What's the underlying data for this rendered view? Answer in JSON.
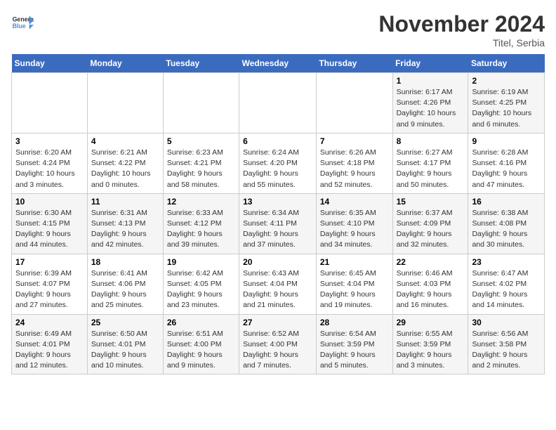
{
  "logo": {
    "text_general": "General",
    "text_blue": "Blue"
  },
  "title": "November 2024",
  "location": "Titel, Serbia",
  "days_of_week": [
    "Sunday",
    "Monday",
    "Tuesday",
    "Wednesday",
    "Thursday",
    "Friday",
    "Saturday"
  ],
  "weeks": [
    [
      {
        "day": "",
        "info": ""
      },
      {
        "day": "",
        "info": ""
      },
      {
        "day": "",
        "info": ""
      },
      {
        "day": "",
        "info": ""
      },
      {
        "day": "",
        "info": ""
      },
      {
        "day": "1",
        "info": "Sunrise: 6:17 AM\nSunset: 4:26 PM\nDaylight: 10 hours and 9 minutes."
      },
      {
        "day": "2",
        "info": "Sunrise: 6:19 AM\nSunset: 4:25 PM\nDaylight: 10 hours and 6 minutes."
      }
    ],
    [
      {
        "day": "3",
        "info": "Sunrise: 6:20 AM\nSunset: 4:24 PM\nDaylight: 10 hours and 3 minutes."
      },
      {
        "day": "4",
        "info": "Sunrise: 6:21 AM\nSunset: 4:22 PM\nDaylight: 10 hours and 0 minutes."
      },
      {
        "day": "5",
        "info": "Sunrise: 6:23 AM\nSunset: 4:21 PM\nDaylight: 9 hours and 58 minutes."
      },
      {
        "day": "6",
        "info": "Sunrise: 6:24 AM\nSunset: 4:20 PM\nDaylight: 9 hours and 55 minutes."
      },
      {
        "day": "7",
        "info": "Sunrise: 6:26 AM\nSunset: 4:18 PM\nDaylight: 9 hours and 52 minutes."
      },
      {
        "day": "8",
        "info": "Sunrise: 6:27 AM\nSunset: 4:17 PM\nDaylight: 9 hours and 50 minutes."
      },
      {
        "day": "9",
        "info": "Sunrise: 6:28 AM\nSunset: 4:16 PM\nDaylight: 9 hours and 47 minutes."
      }
    ],
    [
      {
        "day": "10",
        "info": "Sunrise: 6:30 AM\nSunset: 4:15 PM\nDaylight: 9 hours and 44 minutes."
      },
      {
        "day": "11",
        "info": "Sunrise: 6:31 AM\nSunset: 4:13 PM\nDaylight: 9 hours and 42 minutes."
      },
      {
        "day": "12",
        "info": "Sunrise: 6:33 AM\nSunset: 4:12 PM\nDaylight: 9 hours and 39 minutes."
      },
      {
        "day": "13",
        "info": "Sunrise: 6:34 AM\nSunset: 4:11 PM\nDaylight: 9 hours and 37 minutes."
      },
      {
        "day": "14",
        "info": "Sunrise: 6:35 AM\nSunset: 4:10 PM\nDaylight: 9 hours and 34 minutes."
      },
      {
        "day": "15",
        "info": "Sunrise: 6:37 AM\nSunset: 4:09 PM\nDaylight: 9 hours and 32 minutes."
      },
      {
        "day": "16",
        "info": "Sunrise: 6:38 AM\nSunset: 4:08 PM\nDaylight: 9 hours and 30 minutes."
      }
    ],
    [
      {
        "day": "17",
        "info": "Sunrise: 6:39 AM\nSunset: 4:07 PM\nDaylight: 9 hours and 27 minutes."
      },
      {
        "day": "18",
        "info": "Sunrise: 6:41 AM\nSunset: 4:06 PM\nDaylight: 9 hours and 25 minutes."
      },
      {
        "day": "19",
        "info": "Sunrise: 6:42 AM\nSunset: 4:05 PM\nDaylight: 9 hours and 23 minutes."
      },
      {
        "day": "20",
        "info": "Sunrise: 6:43 AM\nSunset: 4:04 PM\nDaylight: 9 hours and 21 minutes."
      },
      {
        "day": "21",
        "info": "Sunrise: 6:45 AM\nSunset: 4:04 PM\nDaylight: 9 hours and 19 minutes."
      },
      {
        "day": "22",
        "info": "Sunrise: 6:46 AM\nSunset: 4:03 PM\nDaylight: 9 hours and 16 minutes."
      },
      {
        "day": "23",
        "info": "Sunrise: 6:47 AM\nSunset: 4:02 PM\nDaylight: 9 hours and 14 minutes."
      }
    ],
    [
      {
        "day": "24",
        "info": "Sunrise: 6:49 AM\nSunset: 4:01 PM\nDaylight: 9 hours and 12 minutes."
      },
      {
        "day": "25",
        "info": "Sunrise: 6:50 AM\nSunset: 4:01 PM\nDaylight: 9 hours and 10 minutes."
      },
      {
        "day": "26",
        "info": "Sunrise: 6:51 AM\nSunset: 4:00 PM\nDaylight: 9 hours and 9 minutes."
      },
      {
        "day": "27",
        "info": "Sunrise: 6:52 AM\nSunset: 4:00 PM\nDaylight: 9 hours and 7 minutes."
      },
      {
        "day": "28",
        "info": "Sunrise: 6:54 AM\nSunset: 3:59 PM\nDaylight: 9 hours and 5 minutes."
      },
      {
        "day": "29",
        "info": "Sunrise: 6:55 AM\nSunset: 3:59 PM\nDaylight: 9 hours and 3 minutes."
      },
      {
        "day": "30",
        "info": "Sunrise: 6:56 AM\nSunset: 3:58 PM\nDaylight: 9 hours and 2 minutes."
      }
    ]
  ]
}
